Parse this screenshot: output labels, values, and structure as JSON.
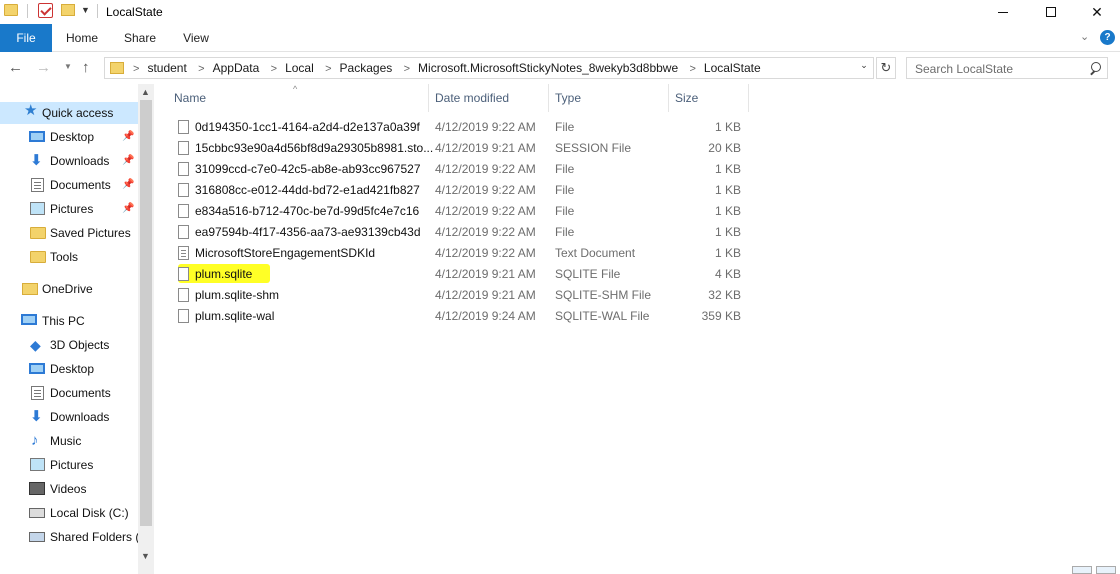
{
  "window": {
    "title": "LocalState"
  },
  "ribbon": {
    "tabs": [
      "File",
      "Home",
      "Share",
      "View"
    ]
  },
  "address": {
    "crumbs": [
      "student",
      "AppData",
      "Local",
      "Packages",
      "Microsoft.MicrosoftStickyNotes_8wekyb3d8bbwe",
      "LocalState"
    ],
    "separator": ">"
  },
  "search": {
    "placeholder": "Search LocalState"
  },
  "nav": {
    "quick_access": "Quick access",
    "items": [
      {
        "label": "Desktop",
        "icon": "desktop-icon",
        "pinned": true
      },
      {
        "label": "Downloads",
        "icon": "download-icon",
        "pinned": true
      },
      {
        "label": "Documents",
        "icon": "documents-icon",
        "pinned": true
      },
      {
        "label": "Pictures",
        "icon": "pictures-icon",
        "pinned": true
      },
      {
        "label": "Saved Pictures",
        "icon": "folder-icon",
        "pinned": false
      },
      {
        "label": "Tools",
        "icon": "folder-icon",
        "pinned": false
      }
    ],
    "onedrive": "OneDrive",
    "this_pc": "This PC",
    "pc_items": [
      {
        "label": "3D Objects",
        "icon": "cube-icon"
      },
      {
        "label": "Desktop",
        "icon": "desktop-icon"
      },
      {
        "label": "Documents",
        "icon": "documents-icon"
      },
      {
        "label": "Downloads",
        "icon": "download-icon"
      },
      {
        "label": "Music",
        "icon": "music-icon"
      },
      {
        "label": "Pictures",
        "icon": "pictures-icon"
      },
      {
        "label": "Videos",
        "icon": "video-icon"
      },
      {
        "label": "Local Disk (C:)",
        "icon": "disk-icon"
      },
      {
        "label": "Shared Folders (\\",
        "icon": "network-folder-icon"
      }
    ]
  },
  "columns": {
    "name": "Name",
    "date": "Date modified",
    "type": "Type",
    "size": "Size"
  },
  "files": [
    {
      "name": "0d194350-1cc1-4164-a2d4-d2e137a0a39f",
      "date": "4/12/2019 9:22 AM",
      "type": "File",
      "size": "1 KB"
    },
    {
      "name": "15cbbc93e90a4d56bf8d9a29305b8981.sto...",
      "date": "4/12/2019 9:21 AM",
      "type": "SESSION File",
      "size": "20 KB"
    },
    {
      "name": "31099ccd-c7e0-42c5-ab8e-ab93cc967527",
      "date": "4/12/2019 9:22 AM",
      "type": "File",
      "size": "1 KB"
    },
    {
      "name": "316808cc-e012-44dd-bd72-e1ad421fb827",
      "date": "4/12/2019 9:22 AM",
      "type": "File",
      "size": "1 KB"
    },
    {
      "name": "e834a516-b712-470c-be7d-99d5fc4e7c16",
      "date": "4/12/2019 9:22 AM",
      "type": "File",
      "size": "1 KB"
    },
    {
      "name": "ea97594b-4f17-4356-aa73-ae93139cb43d",
      "date": "4/12/2019 9:22 AM",
      "type": "File",
      "size": "1 KB"
    },
    {
      "name": "MicrosoftStoreEngagementSDKId",
      "date": "4/12/2019 9:22 AM",
      "type": "Text Document",
      "size": "1 KB"
    },
    {
      "name": "plum.sqlite",
      "date": "4/12/2019 9:21 AM",
      "type": "SQLITE File",
      "size": "4 KB",
      "highlighted": true
    },
    {
      "name": "plum.sqlite-shm",
      "date": "4/12/2019 9:21 AM",
      "type": "SQLITE-SHM File",
      "size": "32 KB"
    },
    {
      "name": "plum.sqlite-wal",
      "date": "4/12/2019 9:24 AM",
      "type": "SQLITE-WAL File",
      "size": "359 KB"
    }
  ],
  "colors": {
    "accent": "#1979ca",
    "selection": "#cce8ff",
    "highlight": "#ffff26"
  }
}
